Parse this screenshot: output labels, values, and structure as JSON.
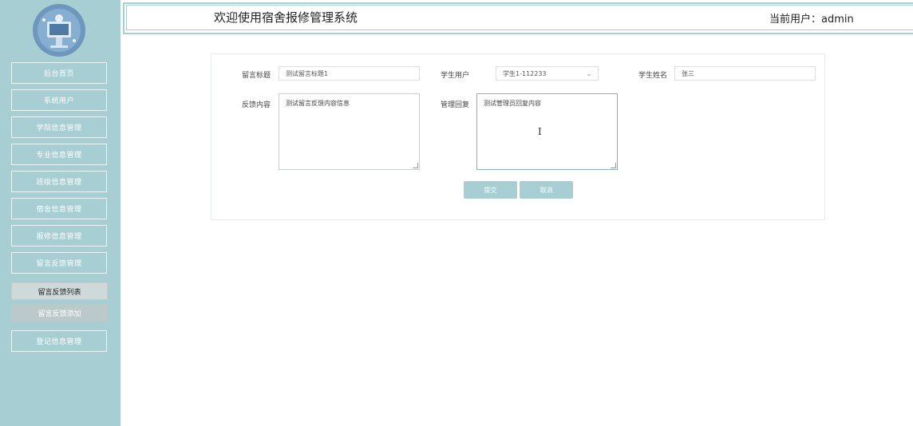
{
  "header": {
    "title": "欢迎使用宿舍报修管理系统",
    "user_label": "当前用户：admin"
  },
  "sidebar": {
    "items": [
      {
        "label": "后台首页"
      },
      {
        "label": "系统用户"
      },
      {
        "label": "学院信息管理"
      },
      {
        "label": "专业信息管理"
      },
      {
        "label": "班级信息管理"
      },
      {
        "label": "宿舍信息管理"
      },
      {
        "label": "报修信息管理"
      },
      {
        "label": "留言反馈管理"
      },
      {
        "label": "登记信息管理"
      }
    ],
    "sub_items": [
      {
        "label": "留言反馈列表",
        "active": true
      },
      {
        "label": "留言反馈添加",
        "active": false
      }
    ]
  },
  "form": {
    "title_label": "留言标题",
    "title_value": "测试留言标题1",
    "student_user_label": "学生用户",
    "student_user_value": "学生1-112233",
    "student_name_label": "学生姓名",
    "student_name_value": "张三",
    "feedback_label": "反馈内容",
    "feedback_value": "测试留言反馈内容信息",
    "reply_label": "管理回复",
    "reply_value": "测试管理员回复内容",
    "submit_label": "提交",
    "cancel_label": "取消"
  },
  "icons": {
    "avatar": "robot-avatar-icon",
    "select_arrow": "chevron-down-icon",
    "text_cursor": "text-cursor-icon"
  },
  "colors": {
    "sidebar_bg": "#a7cfd3",
    "accent": "#a7cfd3"
  }
}
